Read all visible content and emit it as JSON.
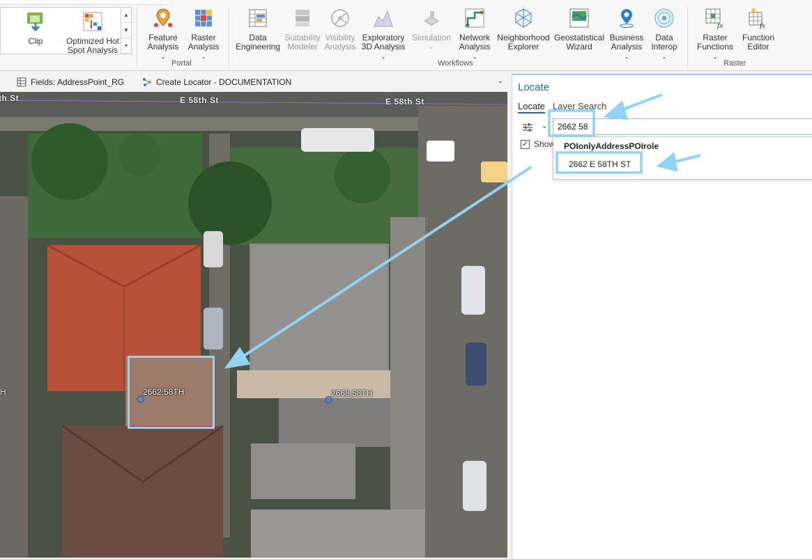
{
  "ribbon": {
    "groups": {
      "portal": "Portal",
      "workflows": "Workflows",
      "raster": "Raster"
    },
    "gallery": {
      "clip": "Clip",
      "hotspot_line1": "Optimized Hot",
      "hotspot_line2": "Spot Analysis"
    },
    "buttons": {
      "feature_analysis": [
        "Feature",
        "Analysis"
      ],
      "raster_analysis": [
        "Raster",
        "Analysis"
      ],
      "data_engineering": [
        "Data",
        "Engineering"
      ],
      "suitability_modeler": [
        "Suitability",
        "Modeler"
      ],
      "visibility_analysis": [
        "Visibility",
        "Analysis"
      ],
      "exploratory_3d": [
        "Exploratory",
        "3D Analysis"
      ],
      "simulation": [
        "Simulation",
        ""
      ],
      "network_analysis": [
        "Network",
        "Analysis"
      ],
      "neighborhood_explorer": [
        "Neighborhood",
        "Explorer"
      ],
      "geostatistical_wizard": [
        "Geostatistical",
        "Wizard"
      ],
      "business_analysis": [
        "Business",
        "Analysis"
      ],
      "data_interop": [
        "Data",
        "Interop"
      ],
      "raster_functions": [
        "Raster",
        "Functions"
      ],
      "function_editor": [
        "Function",
        "Editor"
      ]
    }
  },
  "tabs": [
    {
      "label": "Fields: AddressPoint_RG"
    },
    {
      "label": "Create Locator - DOCUMENTATION"
    }
  ],
  "map": {
    "streets": [
      "th St",
      "E 58th St",
      "E 58th St"
    ],
    "points": [
      {
        "label": "2662,58TH"
      },
      {
        "label": "2668,58TH"
      }
    ],
    "edge_label": "H"
  },
  "locate_pane": {
    "title": "Locate",
    "tabs": [
      "Locate",
      "Layer Search"
    ],
    "search_value": "2662 58",
    "show_label": "Show",
    "suggestions": {
      "group": "POIonlyAddressPOIrole",
      "items": [
        "2662 E 58TH ST"
      ]
    }
  },
  "colors": {
    "highlight": "#8fd3f5",
    "accent": "#1d6aa8",
    "point": "#2f6fd8"
  }
}
